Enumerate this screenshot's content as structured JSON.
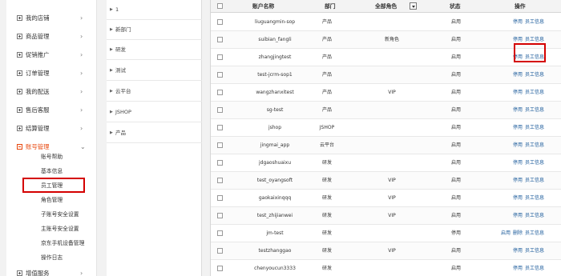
{
  "nav": {
    "items": [
      {
        "label": "我的店铺",
        "expanded": false
      },
      {
        "label": "商品管理",
        "expanded": false
      },
      {
        "label": "促销推广",
        "expanded": false
      },
      {
        "label": "订单管理",
        "expanded": false
      },
      {
        "label": "我的配送",
        "expanded": false
      },
      {
        "label": "售后客服",
        "expanded": false
      },
      {
        "label": "结算管理",
        "expanded": false
      },
      {
        "label": "账号管理",
        "expanded": true
      }
    ],
    "account_sub": [
      "账号帮助",
      "基本信息",
      "员工管理",
      "角色管理",
      "子账号安全设置",
      "主账号安全设置",
      "京东手机设备管理",
      "操作日志"
    ],
    "last_item": {
      "label": "增值服务",
      "expanded": false
    },
    "highlight_color": "#d40000"
  },
  "tree": {
    "items": [
      "1",
      "新部门",
      "研发",
      "测试",
      "云平台",
      "JSHOP",
      "产品"
    ]
  },
  "table": {
    "headers": {
      "account": "账户名称",
      "dept": "部门",
      "role": "全部角色",
      "status": "状态",
      "ops": "操作"
    },
    "rows": [
      {
        "account": "liuguangmin-sop",
        "dept": "产品",
        "role": "",
        "status": "启用",
        "actions": [
          "停用",
          "员工信息"
        ]
      },
      {
        "account": "suibian_fangli",
        "dept": "产品",
        "role": "新角色",
        "status": "启用",
        "actions": [
          "停用",
          "员工信息"
        ]
      },
      {
        "account": "zhangjingtest",
        "dept": "产品",
        "role": "",
        "status": "启用",
        "actions": [
          "停用",
          "员工信息"
        ]
      },
      {
        "account": "test-jcrm-sop1",
        "dept": "产品",
        "role": "",
        "status": "启用",
        "actions": [
          "停用",
          "员工信息"
        ]
      },
      {
        "account": "wangzhanxitest",
        "dept": "产品",
        "role": "VIP",
        "status": "启用",
        "actions": [
          "停用",
          "员工信息"
        ]
      },
      {
        "account": "sg-test",
        "dept": "产品",
        "role": "",
        "status": "启用",
        "actions": [
          "停用",
          "员工信息"
        ]
      },
      {
        "account": "jshop",
        "dept": "JSHOP",
        "role": "",
        "status": "启用",
        "actions": [
          "停用",
          "员工信息"
        ]
      },
      {
        "account": "jingmai_app",
        "dept": "云平台",
        "role": "",
        "status": "启用",
        "actions": [
          "停用",
          "员工信息"
        ]
      },
      {
        "account": "jdgaoshuaixu",
        "dept": "研发",
        "role": "",
        "status": "启用",
        "actions": [
          "停用",
          "员工信息"
        ]
      },
      {
        "account": "test_oyangsoft",
        "dept": "研发",
        "role": "VIP",
        "status": "启用",
        "actions": [
          "停用",
          "员工信息"
        ]
      },
      {
        "account": "gaokaixinqqq",
        "dept": "研发",
        "role": "VIP",
        "status": "启用",
        "actions": [
          "停用",
          "员工信息"
        ]
      },
      {
        "account": "test_zhijianwei",
        "dept": "研发",
        "role": "VIP",
        "status": "启用",
        "actions": [
          "停用",
          "员工信息"
        ]
      },
      {
        "account": "jm-test",
        "dept": "研发",
        "role": "",
        "status": "停用",
        "actions": [
          "启用",
          "删除",
          "员工信息"
        ]
      },
      {
        "account": "testzhanggao",
        "dept": "研发",
        "role": "VIP",
        "status": "启用",
        "actions": [
          "停用",
          "员工信息"
        ]
      },
      {
        "account": "chenyoucun3333",
        "dept": "研发",
        "role": "",
        "status": "启用",
        "actions": [
          "停用",
          "员工信息"
        ]
      }
    ]
  },
  "colors": {
    "link": "#1a5a9a",
    "active_nav": "#e8470d",
    "highlight_box": "#d40000"
  }
}
